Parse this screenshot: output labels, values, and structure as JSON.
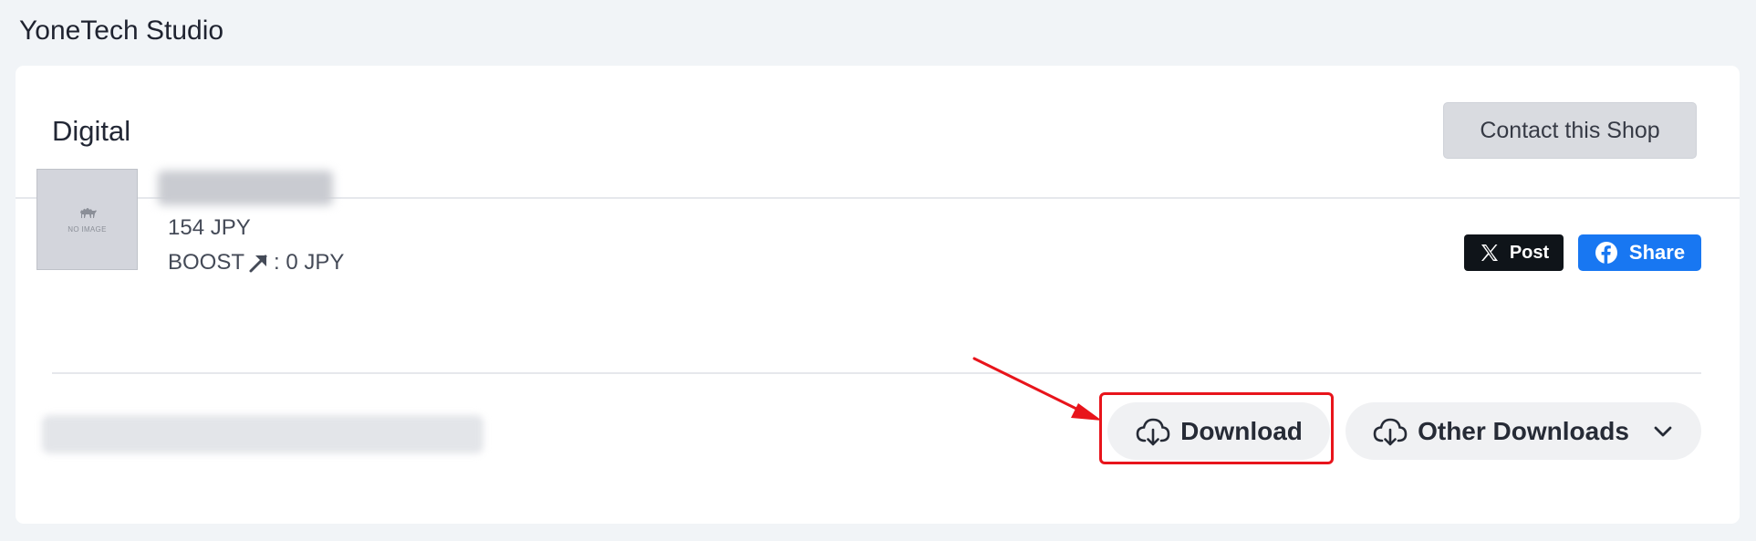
{
  "header": {
    "shop_name": "YoneTech Studio"
  },
  "section": {
    "title": "Digital",
    "contact_button": "Contact this Shop"
  },
  "item": {
    "title": "",
    "thumbnail_text": "NO IMAGE",
    "price": "154 JPY",
    "boost_label": "BOOST",
    "boost_value": ": 0 JPY"
  },
  "social": {
    "post_label": "Post",
    "share_label": "Share"
  },
  "download": {
    "file_name": "",
    "download_label": "Download",
    "other_downloads_label": "Other Downloads"
  },
  "colors": {
    "page_bg": "#f1f4f7",
    "x_brand": "#0f1419",
    "facebook_brand": "#1877f2",
    "annotation_red": "#e8141b"
  },
  "icons": [
    "camel-icon",
    "arrow-up-right-icon",
    "x-logo-icon",
    "facebook-logo-icon",
    "cloud-download-icon",
    "chevron-down-icon"
  ]
}
